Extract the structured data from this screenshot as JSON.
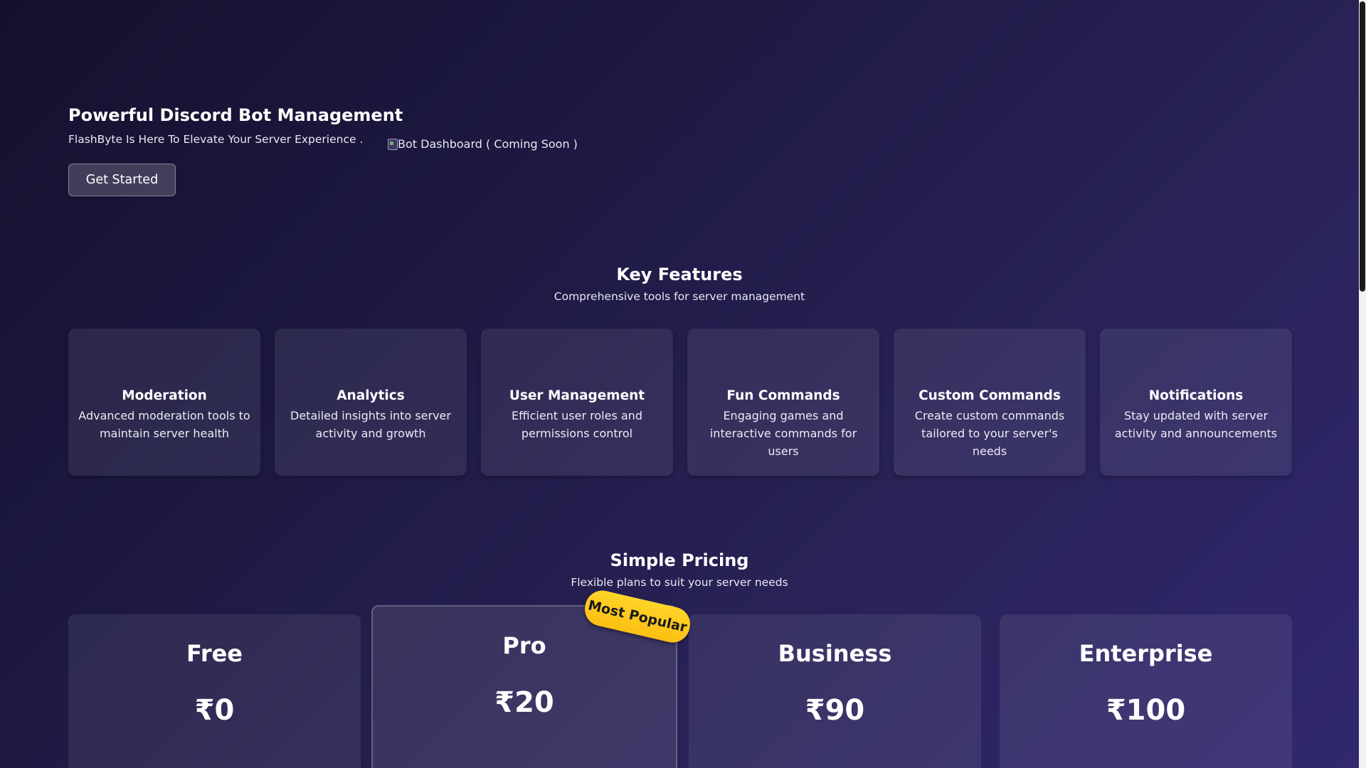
{
  "hero": {
    "title": "Powerful Discord Bot Management",
    "subtitle": "FlashByte Is Here To Elevate Your Server Experience .",
    "image_alt": "Bot Dashboard ( Coming Soon )",
    "cta_label": "Get Started"
  },
  "features": {
    "title": "Key Features",
    "subtitle": "Comprehensive tools for server management",
    "items": [
      {
        "title": "Moderation",
        "description": "Advanced moderation tools to maintain server health"
      },
      {
        "title": "Analytics",
        "description": "Detailed insights into server activity and growth"
      },
      {
        "title": "User Management",
        "description": "Efficient user roles and permissions control"
      },
      {
        "title": "Fun Commands",
        "description": "Engaging games and interactive commands for users"
      },
      {
        "title": "Custom Commands",
        "description": "Create custom commands tailored to your server's needs"
      },
      {
        "title": "Notifications",
        "description": "Stay updated with server activity and announcements"
      }
    ]
  },
  "pricing": {
    "title": "Simple Pricing",
    "subtitle": "Flexible plans to suit your server needs",
    "badge": "Most Popular",
    "plans": [
      {
        "name": "Free",
        "price": "₹0"
      },
      {
        "name": "Pro",
        "price": "₹20",
        "popular": true
      },
      {
        "name": "Business",
        "price": "₹90"
      },
      {
        "name": "Enterprise",
        "price": "₹100"
      }
    ]
  },
  "colors": {
    "background_start": "#14112e",
    "background_end": "#312870",
    "badge": "#fcbf12"
  }
}
